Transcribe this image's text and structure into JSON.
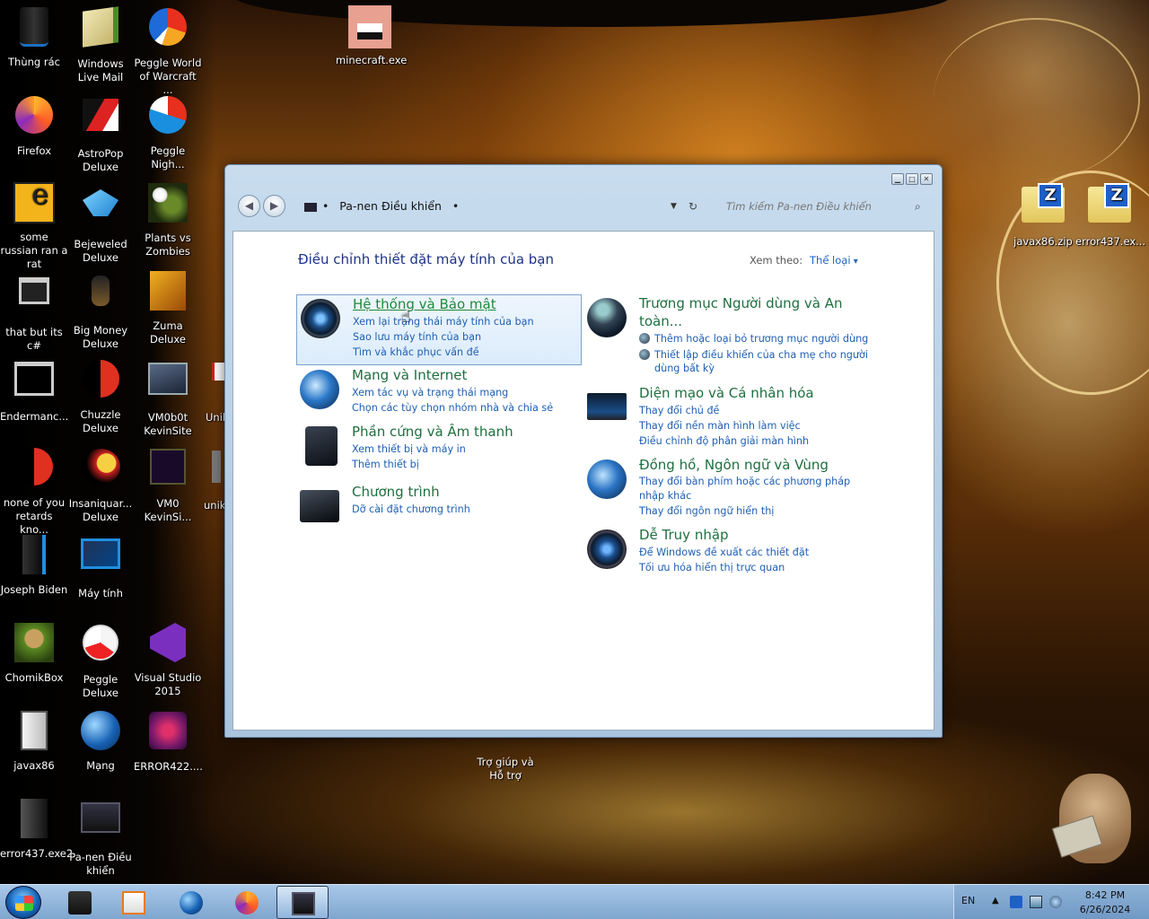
{
  "desktop_icons": [
    {
      "label": "Thùng rác",
      "icon": "recycle-bin-icon"
    },
    {
      "label": "Windows Live Mail",
      "icon": "mail-icon"
    },
    {
      "label": "Peggle World of Warcraft ...",
      "icon": "peggle-icon"
    },
    {
      "label": "minecraft.exe",
      "icon": "minecraft-icon"
    },
    {
      "label": "Firefox",
      "icon": "firefox-icon"
    },
    {
      "label": "AstroPop Deluxe",
      "icon": "astropop-icon"
    },
    {
      "label": "Peggle Nigh...",
      "icon": "peggle-icon"
    },
    {
      "label": "some russian ran a rat",
      "icon": "app-icon"
    },
    {
      "label": "Bejeweled Deluxe",
      "icon": "bejeweled-icon"
    },
    {
      "label": "Plants vs Zombies",
      "icon": "pvz-icon"
    },
    {
      "label": "that but its c#",
      "icon": "window-icon"
    },
    {
      "label": "Big Money Deluxe",
      "icon": "game-icon"
    },
    {
      "label": "Zuma Deluxe",
      "icon": "zuma-icon"
    },
    {
      "label": "Endermanc...",
      "icon": "window-icon"
    },
    {
      "label": "Chuzzle Deluxe",
      "icon": "chuzzle-icon"
    },
    {
      "label": "VM0b0t KevinSite",
      "icon": "vm-icon"
    },
    {
      "label": "Unik",
      "icon": "app-icon"
    },
    {
      "label": "none of you retards kno...",
      "icon": "app-icon"
    },
    {
      "label": "Insaniquar... Deluxe",
      "icon": "game-icon"
    },
    {
      "label": "VM0 KevinSi...",
      "icon": "vm-icon"
    },
    {
      "label": "unik",
      "icon": "app-icon"
    },
    {
      "label": "Joseph Biden",
      "icon": "computer-icon"
    },
    {
      "label": "Máy tính",
      "icon": "monitor-icon"
    },
    {
      "label": "ChomikBox",
      "icon": "chomikbox-icon"
    },
    {
      "label": "Peggle Deluxe",
      "icon": "peggle-icon"
    },
    {
      "label": "Visual Studio 2015",
      "icon": "visual-studio-icon"
    },
    {
      "label": "javax86",
      "icon": "document-icon"
    },
    {
      "label": "Mạng",
      "icon": "network-globe-icon"
    },
    {
      "label": "ERROR422....",
      "icon": "cube-icon"
    },
    {
      "label": "error437.exe2",
      "icon": "exe-icon"
    },
    {
      "label": "Pa-nen Điều khiển",
      "icon": "control-panel-icon"
    },
    {
      "label": "javax86.zip",
      "icon": "zip-icon"
    },
    {
      "label": "error437.ex...",
      "icon": "zip-icon"
    },
    {
      "label": "Trợ giúp và Hỗ trợ",
      "icon": "help-icon"
    }
  ],
  "window": {
    "breadcrumb": "Pa-nen Điều khiển",
    "search_placeholder": "Tìm kiếm Pa-nen Điều khiển",
    "title": "Điều chỉnh thiết đặt máy tính của bạn",
    "view_by_label": "Xem theo:",
    "view_by_value": "Thể loại",
    "categories_left": [
      {
        "title": "Hệ thống và Bảo mật",
        "links": [
          "Xem lại trạng thái máy tính của bạn",
          "Sao lưu máy tính của bạn",
          "Tìm và khắc phục vấn đề"
        ]
      },
      {
        "title": "Mạng và Internet",
        "links": [
          "Xem tác vụ và trạng thái mạng",
          "Chọn các tùy chọn nhóm nhà và chia sẻ"
        ]
      },
      {
        "title": "Phần cứng và Âm thanh",
        "links": [
          "Xem thiết bị và máy in",
          "Thêm thiết bị"
        ]
      },
      {
        "title": "Chương trình",
        "links": [
          "Dỡ cài đặt chương trình"
        ]
      }
    ],
    "categories_right": [
      {
        "title": "Trương mục Người dùng và An toàn...",
        "links": [
          "Thêm hoặc loại bỏ trương mục người dùng",
          "Thiết lập điều khiển của cha mẹ cho người dùng bất kỳ"
        ]
      },
      {
        "title": "Diện mạo và Cá nhân hóa",
        "links": [
          "Thay đổi chủ đề",
          "Thay đổi nền màn hình làm việc",
          "Điều chỉnh độ phân giải màn hình"
        ]
      },
      {
        "title": "Đồng hồ, Ngôn ngữ và Vùng",
        "links": [
          "Thay đổi bàn phím hoặc các phương pháp nhập khác",
          "Thay đổi ngôn ngữ hiển thị"
        ]
      },
      {
        "title": "Dễ Truy nhập",
        "links": [
          "Để Windows đề xuất các thiết đặt",
          "Tối ưu hóa hiển thị trực quan"
        ]
      }
    ]
  },
  "taskbar": {
    "language": "EN",
    "time": "8:42 PM",
    "date": "6/26/2024"
  }
}
